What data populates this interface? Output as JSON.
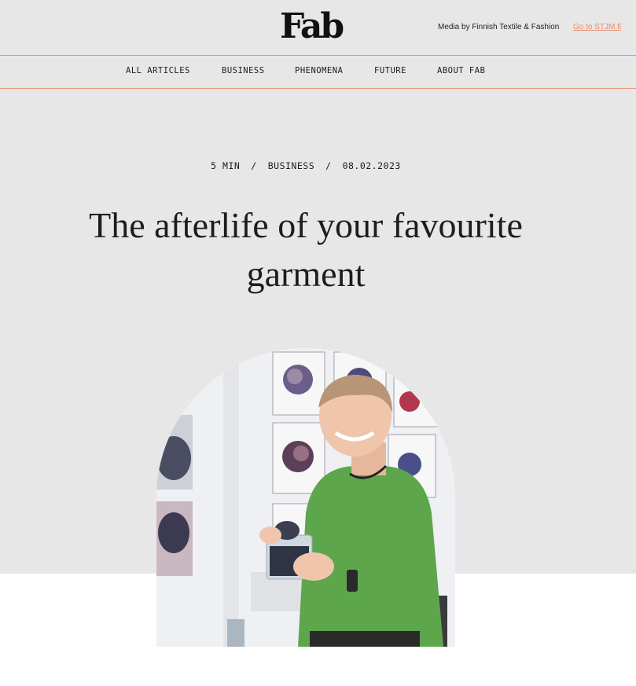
{
  "header": {
    "logo": "Fab",
    "media_by": "Media by Finnish Textile & Fashion",
    "goto_link": "Go to STJM.fi"
  },
  "nav": {
    "items": [
      "ALL ARTICLES",
      "BUSINESS",
      "PHENOMENA",
      "FUTURE",
      "ABOUT FAB"
    ]
  },
  "article": {
    "read_time": "5 MIN",
    "category": "BUSINESS",
    "date": "08.02.2023",
    "separator": "/",
    "title_line1": "The afterlife of your favourite",
    "title_line2": "garment"
  },
  "colors": {
    "background": "#e8e7e7",
    "accent": "#e9987a",
    "cardigan_green": "#5da64c"
  }
}
